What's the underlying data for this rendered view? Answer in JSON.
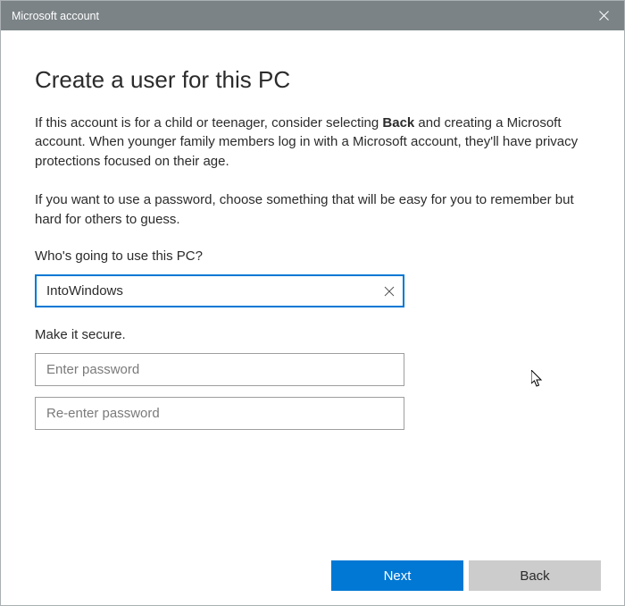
{
  "titlebar": {
    "title": "Microsoft account"
  },
  "heading": "Create a user for this PC",
  "para1_pre": "If this account is for a child or teenager, consider selecting ",
  "para1_bold": "Back",
  "para1_post": " and creating a Microsoft account. When younger family members log in with a Microsoft account, they'll have privacy protections focused on their age.",
  "para2": "If you want to use a password, choose something that will be easy for you to remember but hard for others to guess.",
  "username_label": "Who's going to use this PC?",
  "username_value": "IntoWindows",
  "secure_label": "Make it secure.",
  "password_placeholder": "Enter password",
  "reenter_placeholder": "Re-enter password",
  "buttons": {
    "next": "Next",
    "back": "Back"
  },
  "colors": {
    "titlebar_bg": "#7b8386",
    "accent": "#0078d4",
    "button_secondary": "#cccccc"
  }
}
